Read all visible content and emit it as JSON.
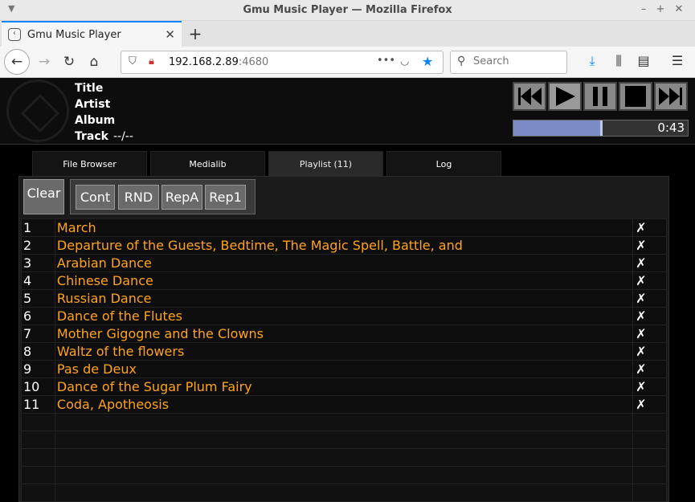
{
  "window": {
    "title": "Gmu Music Player — Mozilla Firefox"
  },
  "browser": {
    "tab_label": "Gmu Music Player",
    "url_host": "192.168.2.89",
    "url_port": ":4680",
    "search_placeholder": "Search"
  },
  "player": {
    "labels": {
      "title": "Title",
      "artist": "Artist",
      "album": "Album",
      "track": "Track"
    },
    "track_value": "--/--",
    "time": "0:43",
    "progress_fraction": 0.5,
    "controls": [
      "prev-icon",
      "play-icon",
      "pause-icon",
      "stop-icon",
      "next-icon"
    ]
  },
  "tabs": [
    {
      "label": "File Browser"
    },
    {
      "label": "Medialib"
    },
    {
      "label": "Playlist (11)"
    },
    {
      "label": "Log"
    }
  ],
  "playlist_toolbar": {
    "clear": "Clear",
    "modes": [
      "Cont",
      "RND",
      "RepA",
      "Rep1"
    ]
  },
  "playlist": {
    "delete_glyph": "✗",
    "rows": [
      {
        "n": "1",
        "title": "March"
      },
      {
        "n": "2",
        "title": "Departure of the Guests, Bedtime, The Magic Spell, Battle, and"
      },
      {
        "n": "3",
        "title": "Arabian Dance"
      },
      {
        "n": "4",
        "title": "Chinese Dance"
      },
      {
        "n": "5",
        "title": "Russian Dance"
      },
      {
        "n": "6",
        "title": "Dance of the Flutes"
      },
      {
        "n": "7",
        "title": "Mother Gigogne and the Clowns"
      },
      {
        "n": "8",
        "title": "Waltz of the flowers"
      },
      {
        "n": "9",
        "title": "Pas de Deux"
      },
      {
        "n": "10",
        "title": "Dance of the Sugar Plum Fairy"
      },
      {
        "n": "11",
        "title": "Coda, Apotheosis"
      }
    ]
  }
}
